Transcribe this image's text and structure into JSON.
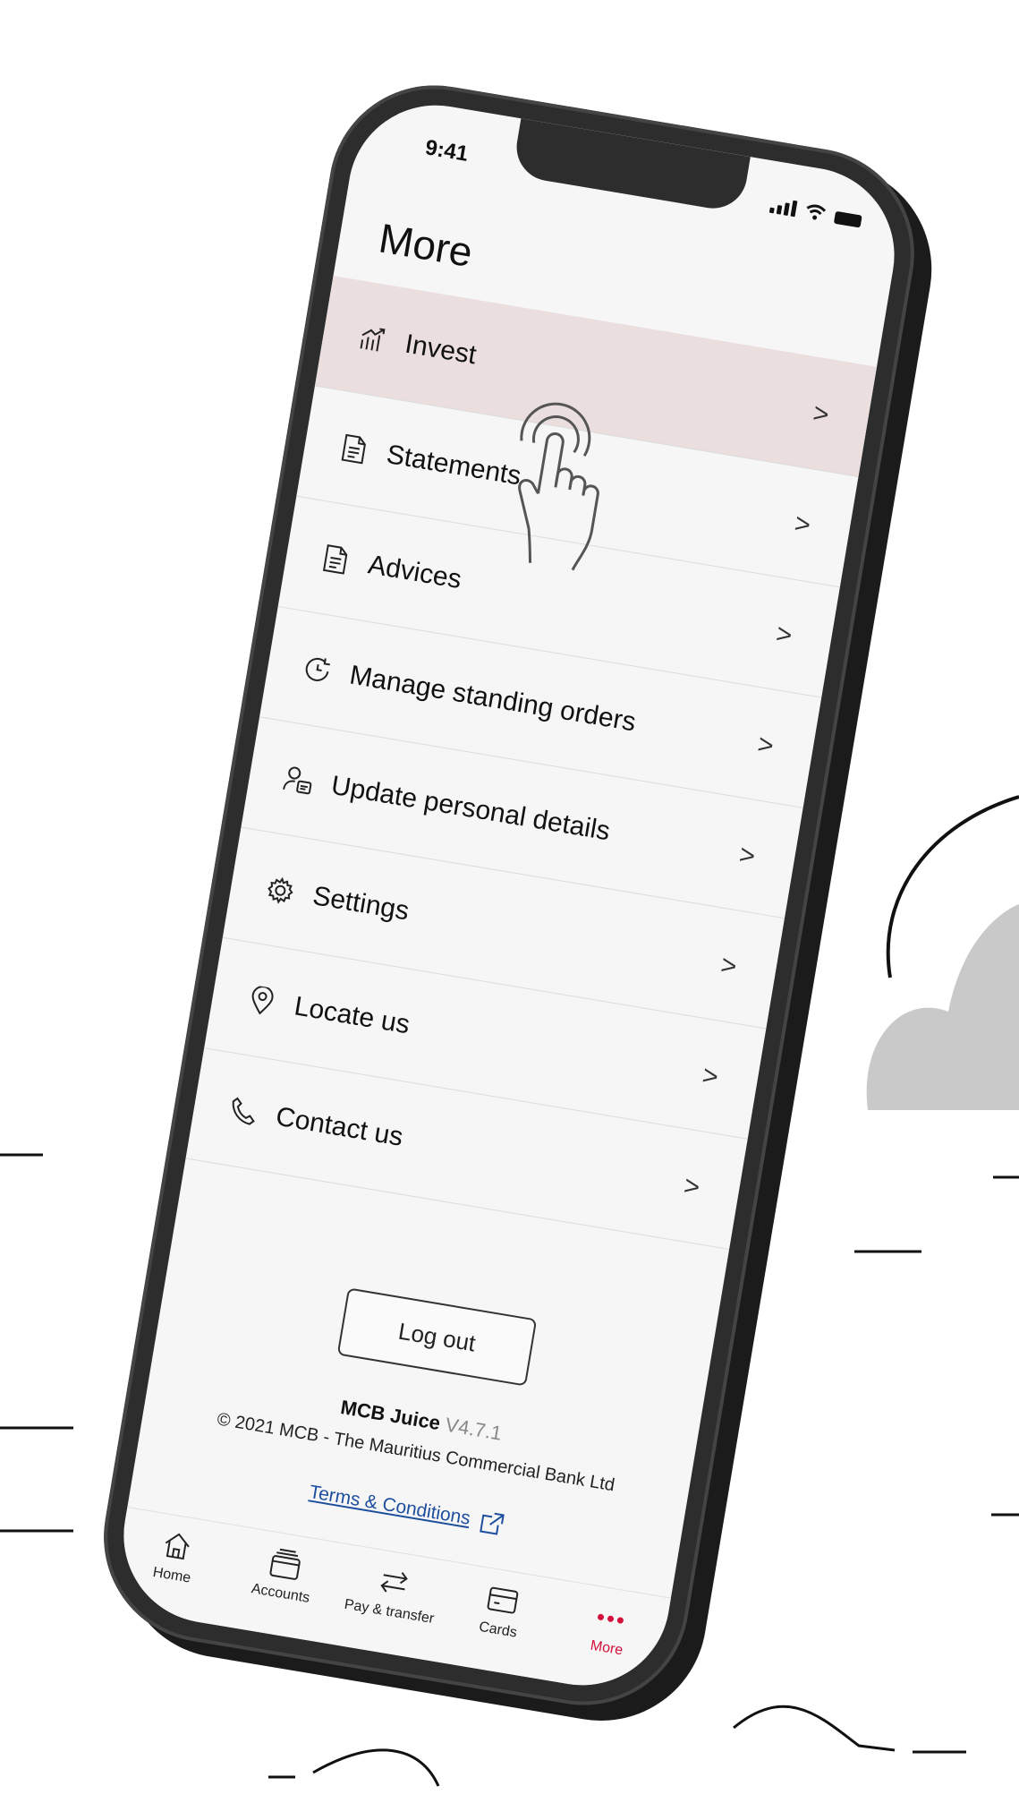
{
  "status_bar": {
    "time": "9:41"
  },
  "page": {
    "title": "More"
  },
  "menu": {
    "items": [
      {
        "label": "Invest",
        "icon": "invest-chart-icon",
        "selected": true
      },
      {
        "label": "Statements",
        "icon": "document-icon"
      },
      {
        "label": "Advices",
        "icon": "document-icon"
      },
      {
        "label": "Manage standing orders",
        "icon": "clock-refresh-icon"
      },
      {
        "label": "Update personal details",
        "icon": "user-card-icon"
      },
      {
        "label": "Settings",
        "icon": "gear-icon"
      },
      {
        "label": "Locate us",
        "icon": "location-pin-icon"
      },
      {
        "label": "Contact us",
        "icon": "phone-icon"
      }
    ],
    "chevron": ">"
  },
  "logout": {
    "label": "Log out"
  },
  "footer": {
    "app_name": "MCB Juice",
    "version": "V4.7.1",
    "copyright": "© 2021 MCB - The Mauritius Commercial Bank Ltd",
    "terms_label": "Terms & Conditions"
  },
  "tabbar": {
    "items": [
      {
        "label": "Home",
        "icon": "home-icon"
      },
      {
        "label": "Accounts",
        "icon": "accounts-icon"
      },
      {
        "label": "Pay & transfer",
        "icon": "transfer-arrows-icon"
      },
      {
        "label": "Cards",
        "icon": "card-icon"
      },
      {
        "label": "More",
        "icon": "more-dots-icon",
        "active": true
      }
    ]
  },
  "colors": {
    "accent": "#d3113b",
    "selected_row": "#ebdedf",
    "link": "#1d4e9e"
  }
}
